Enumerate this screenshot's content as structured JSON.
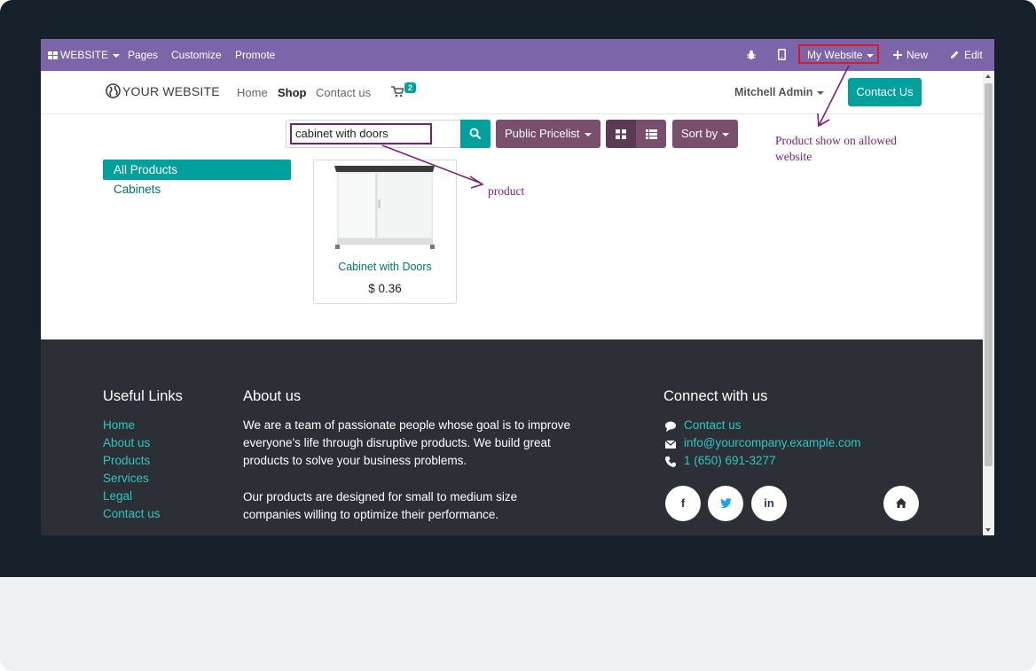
{
  "topbar": {
    "website_menu": "WEBSITE",
    "pages": "Pages",
    "customize": "Customize",
    "promote": "Promote",
    "my_website": "My Website",
    "new": "New",
    "edit": "Edit"
  },
  "header": {
    "logo_text": "YOUR WEBSITE",
    "nav_home": "Home",
    "nav_shop": "Shop",
    "nav_contact": "Contact us",
    "cart_count": "2",
    "user": "Mitchell Admin",
    "contact_button": "Contact Us"
  },
  "toolbar": {
    "search_value": "cabinet with doors",
    "pricelist": "Public Pricelist",
    "sort": "Sort by"
  },
  "categories": [
    {
      "label": "All Products",
      "active": true
    },
    {
      "label": "Cabinets",
      "active": false
    }
  ],
  "product": {
    "name": "Cabinet with Doors",
    "price": "$ 0.36"
  },
  "annotations": {
    "product_note": "product",
    "website_note_line1": "Product show on allowed",
    "website_note_line2": "website"
  },
  "footer": {
    "useful_links_title": "Useful Links",
    "links": [
      "Home",
      "About us",
      "Products",
      "Services",
      "Legal",
      "Contact us"
    ],
    "about_title": "About us",
    "about_p1": [
      "We are a team of passionate people whose goal is to improve",
      "everyone's life through disruptive products. We build great",
      "products to solve your business problems."
    ],
    "about_p2": [
      "Our products are designed for small to medium size",
      "companies willing to optimize their performance."
    ],
    "connect_title": "Connect with us",
    "contact_us": "Contact us",
    "email": "info@yourcompany.example.com",
    "phone": "1 (650) 691-3277",
    "social": [
      "f",
      "t",
      "in"
    ]
  },
  "colors": {
    "topbar": "#7c65a8",
    "accent": "#00a09d",
    "plum": "#7a4f6e",
    "footer": "#2c2f36",
    "annotation": "#7a1f7a",
    "highlight_box": "#d81b24"
  }
}
